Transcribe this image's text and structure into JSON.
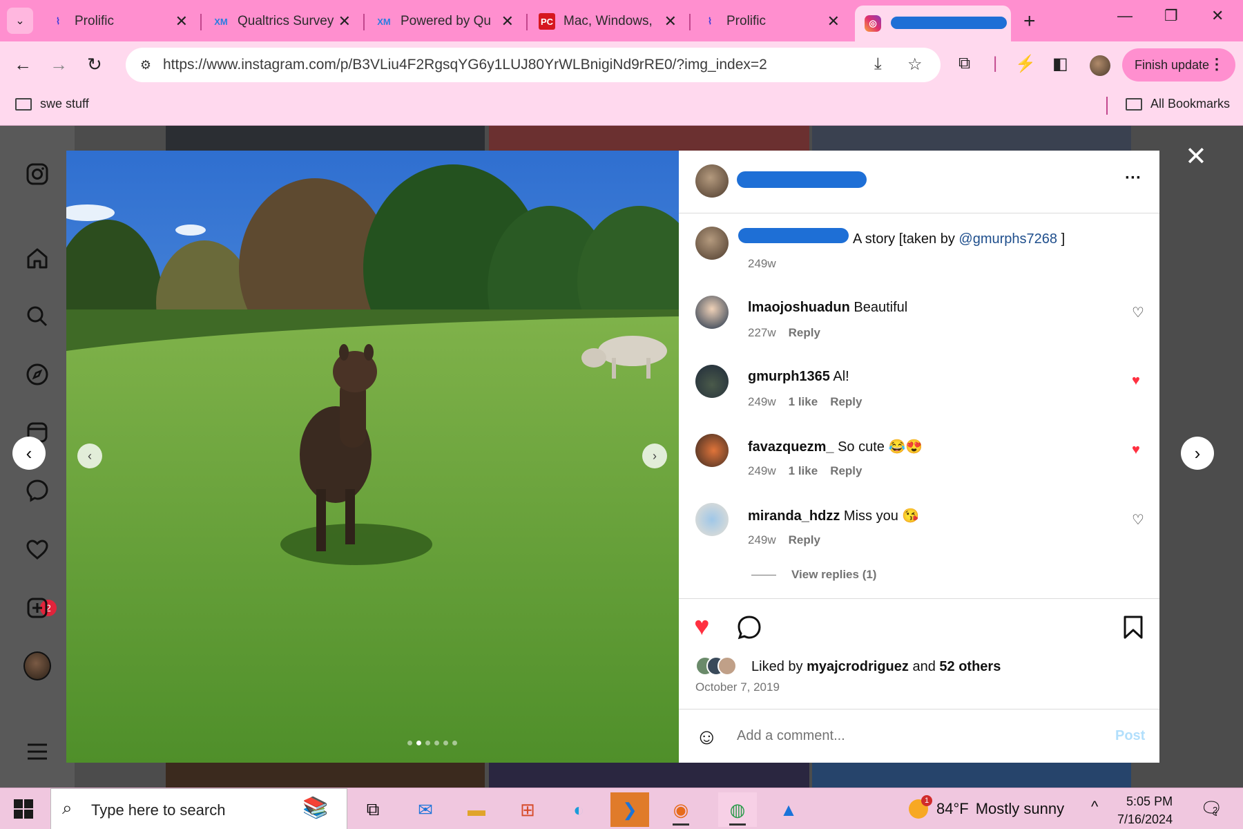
{
  "browser": {
    "tabs": [
      {
        "title": "Prolific",
        "favicon": "prolific-icon",
        "active": false
      },
      {
        "title": "Qualtrics Survey",
        "favicon": "qualtrics-icon",
        "active": false
      },
      {
        "title": "Powered by Qua",
        "favicon": "qualtrics-icon",
        "active": false
      },
      {
        "title": "Mac, Windows, (",
        "favicon": "pcmag-icon",
        "active": false
      },
      {
        "title": "Prolific",
        "favicon": "prolific-icon",
        "active": false
      },
      {
        "title": "",
        "favicon": "instagram-icon",
        "active": true
      }
    ],
    "url": "https://www.instagram.com/p/B3VLiu4F2RgsqYG6y1LUJ80YrWLBnigiNd9rRE0/?img_index=2",
    "finish_update_label": "Finish update",
    "bookmarks": [
      "swe stuff"
    ],
    "all_bookmarks_label": "All Bookmarks"
  },
  "post": {
    "caption_text": "A story [taken by",
    "caption_mention": "@gmurphs7268",
    "caption_end": "]",
    "caption_time": "249w",
    "comments": [
      {
        "user": "lmaojoshuadun",
        "text": "Beautiful",
        "time": "227w",
        "likes": "",
        "reply": "Reply",
        "liked": false
      },
      {
        "user": "gmurph1365",
        "text": "Al!",
        "time": "249w",
        "likes": "1 like",
        "reply": "Reply",
        "liked": true
      },
      {
        "user": "favazquezm_",
        "text": "So cute 😂😍",
        "time": "249w",
        "likes": "1 like",
        "reply": "Reply",
        "liked": true
      },
      {
        "user": "miranda_hdzz",
        "text": "Miss you 😘",
        "time": "249w",
        "likes": "",
        "reply": "Reply",
        "liked": false
      }
    ],
    "view_replies": "View replies (1)",
    "liked_by_prefix": "Liked by",
    "liked_by_user": "myajcrodriguez",
    "liked_by_and": "and",
    "liked_by_others": "52 others",
    "date": "October 7, 2019",
    "comment_placeholder": "Add a comment...",
    "post_label": "Post"
  },
  "sidebar": {
    "messages_badge": "2"
  },
  "taskbar": {
    "search_placeholder": "Type here to search",
    "weather_temp": "84°F",
    "weather_desc": "Mostly sunny",
    "weather_badge": "1",
    "time": "5:05 PM",
    "date": "7/16/2024",
    "notif_count": "2"
  },
  "colors": {
    "tabbar": "#ff8fcf",
    "toolbar": "#ffd9ee",
    "like_red": "#ff3040",
    "mention_blue": "#1e4e8c"
  }
}
